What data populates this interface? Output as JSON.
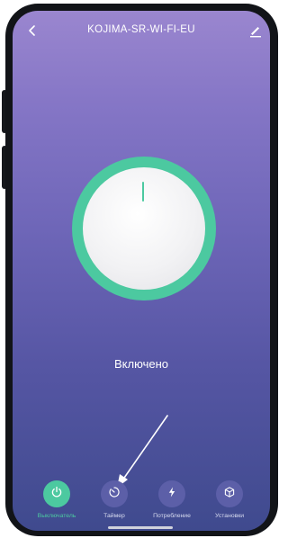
{
  "header": {
    "title": "KOJIMA-SR-WI-FI-EU",
    "back_icon": "chevron-left-icon",
    "edit_icon": "pencil-icon"
  },
  "main": {
    "status_text": "Включено",
    "power_state": "on"
  },
  "nav": {
    "items": [
      {
        "label": "Выключатель",
        "icon": "power-icon",
        "active": true
      },
      {
        "label": "Таймер",
        "icon": "timer-icon",
        "active": false
      },
      {
        "label": "Потребление",
        "icon": "lightning-icon",
        "active": false
      },
      {
        "label": "Установки",
        "icon": "cube-icon",
        "active": false
      }
    ]
  },
  "colors": {
    "accent": "#4cc9a0",
    "background_top": "#9a86cf",
    "background_bottom": "#3f4a8e",
    "nav_button": "#5c5fa8"
  }
}
